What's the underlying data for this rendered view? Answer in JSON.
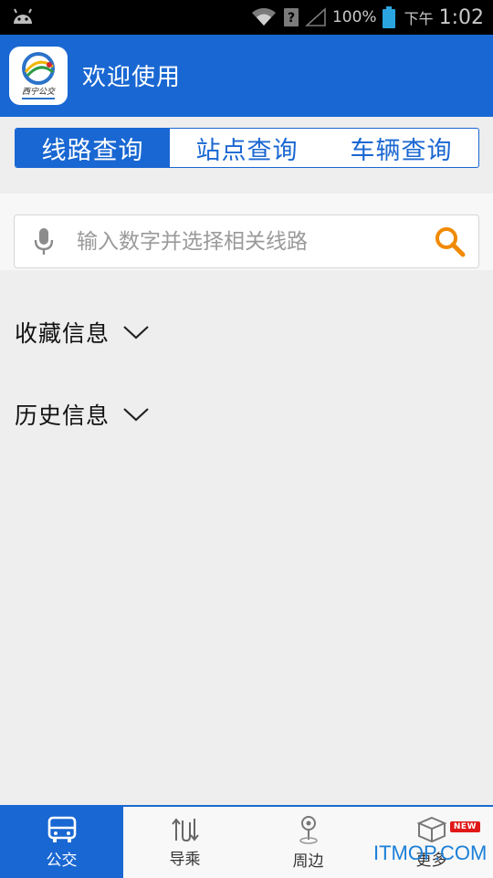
{
  "status_bar": {
    "battery_percent": "100%",
    "ampm": "下午",
    "time": "1:02"
  },
  "header": {
    "title": "欢迎使用",
    "logo_text": "西宁公交"
  },
  "tabs": [
    {
      "label": "线路查询",
      "active": true
    },
    {
      "label": "站点查询",
      "active": false
    },
    {
      "label": "车辆查询",
      "active": false
    }
  ],
  "search": {
    "placeholder": "输入数字并选择相关线路",
    "value": ""
  },
  "sections": {
    "favorites": "收藏信息",
    "history": "历史信息"
  },
  "bottom_nav": [
    {
      "label": "公交",
      "icon": "bus-icon",
      "active": true
    },
    {
      "label": "导乘",
      "icon": "transfer-icon",
      "active": false
    },
    {
      "label": "周边",
      "icon": "location-pin-icon",
      "active": false
    },
    {
      "label": "更多",
      "icon": "more-boxes-icon",
      "active": false,
      "badge": "NEW"
    }
  ],
  "watermark": "ITMOP.COM",
  "colors": {
    "primary": "#1967d2",
    "accent_search": "#f08a00",
    "background": "#eeeeee"
  }
}
